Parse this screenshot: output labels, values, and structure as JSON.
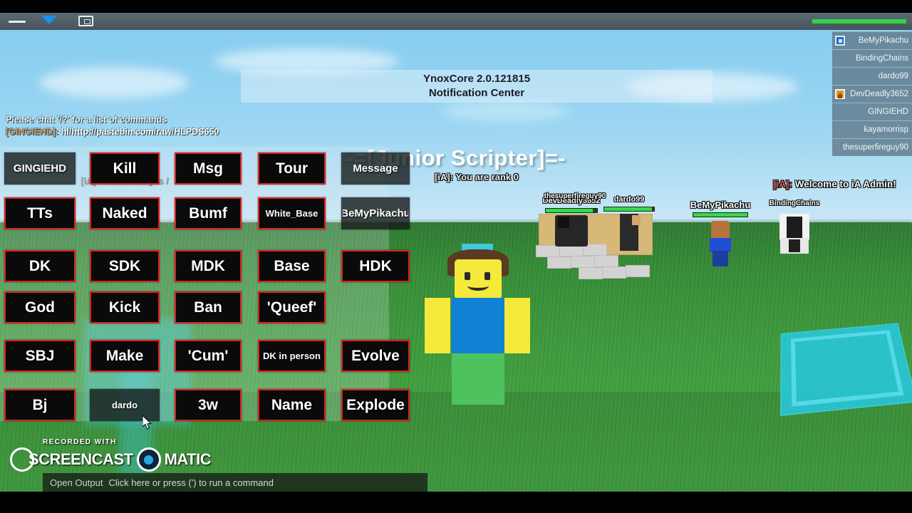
{
  "window": {
    "topbar": {
      "menu_icon": "hamburger-menu-icon",
      "chevron_icon": "chevron-down-icon",
      "camera_icon": "camera-icon",
      "health_label": "100"
    }
  },
  "notification_center": {
    "line1": "YnoxCore 2.0.121815",
    "line2": "Notification Center"
  },
  "chat": {
    "lines": [
      {
        "user": "",
        "text": "Please chat '/?' for a list of commands",
        "style": "system"
      },
      {
        "user": "[GINGIEHD]:",
        "text": "hl/http://pastebin.com/raw/HLPDS650",
        "style": "player"
      }
    ],
    "betkey_line": "[iA]: Your BetKey is /",
    "input_label": "Open Output",
    "input_hint": "Click here or press (') to run a command"
  },
  "world_text": {
    "title": "-=[Junior Scripter]=-",
    "rank_message": "[iA]: You are rank 0",
    "welcome_tag": "[iA]:",
    "welcome_message": " Welcome to iA Admin!"
  },
  "admin_panel": {
    "buttons": [
      {
        "label": "GINGIEHD",
        "style": "plain",
        "size": "md"
      },
      {
        "label": "Kill",
        "style": "red",
        "size": "lg"
      },
      {
        "label": "Msg",
        "style": "red",
        "size": "lg"
      },
      {
        "label": "Tour",
        "style": "red",
        "size": "lg"
      },
      {
        "label": "Message",
        "style": "plain",
        "size": "md"
      },
      {
        "label": "TTs",
        "style": "red",
        "size": "lg"
      },
      {
        "label": "Naked",
        "style": "red",
        "size": "lg"
      },
      {
        "label": "Bumf",
        "style": "red",
        "size": "lg"
      },
      {
        "label": "White_Base",
        "style": "red",
        "size": "sm"
      },
      {
        "label": "BeMyPikachu",
        "style": "plain",
        "size": "md"
      },
      {
        "label": "DK",
        "style": "red",
        "size": "lg"
      },
      {
        "label": "SDK",
        "style": "red",
        "size": "lg"
      },
      {
        "label": "MDK",
        "style": "red",
        "size": "lg"
      },
      {
        "label": "Base",
        "style": "red",
        "size": "lg"
      },
      {
        "label": "HDK",
        "style": "red",
        "size": "lg"
      },
      {
        "label": "God",
        "style": "red",
        "size": "lg"
      },
      {
        "label": "Kick",
        "style": "red",
        "size": "lg"
      },
      {
        "label": "Ban",
        "style": "red",
        "size": "lg"
      },
      {
        "label": "'Queef'",
        "style": "red",
        "size": "lg"
      },
      {
        "label": "",
        "style": "none",
        "size": "lg"
      },
      {
        "label": "SBJ",
        "style": "red",
        "size": "lg"
      },
      {
        "label": "Make",
        "style": "red",
        "size": "lg"
      },
      {
        "label": "'Cum'",
        "style": "red",
        "size": "lg"
      },
      {
        "label": "DK in person",
        "style": "red",
        "size": "sm"
      },
      {
        "label": "Evolve",
        "style": "red",
        "size": "lg"
      },
      {
        "label": "Bj",
        "style": "red",
        "size": "lg"
      },
      {
        "label": "dardo",
        "style": "plain",
        "size": "sm"
      },
      {
        "label": "3w",
        "style": "red",
        "size": "lg"
      },
      {
        "label": "Name",
        "style": "red",
        "size": "lg"
      },
      {
        "label": "Explode",
        "style": "red",
        "size": "lg"
      }
    ]
  },
  "player_list": {
    "players": [
      {
        "name": "BeMyPikachu",
        "badge": "blue"
      },
      {
        "name": "BindingChains",
        "badge": "none"
      },
      {
        "name": "dardo99",
        "badge": "none"
      },
      {
        "name": "DevDeadly3652",
        "badge": "gold"
      },
      {
        "name": "GINGIEHD",
        "badge": "none"
      },
      {
        "name": "kayamorrisp",
        "badge": "none"
      },
      {
        "name": "thesuperfireguy90",
        "badge": "none"
      }
    ]
  },
  "avatars": {
    "dev": {
      "name": "DevDeadly3652"
    },
    "dardo": {
      "name": "dardo99"
    },
    "fire": {
      "name": "thesuperfireguy90"
    },
    "pika": {
      "name": "BeMyPikachu"
    },
    "chains": {
      "name": "BindingChains"
    }
  },
  "watermark": {
    "recorded_with": "RECORDED WITH",
    "word1": "SCREENCAST",
    "word2": "MATIC"
  },
  "colors": {
    "button_border": "#e02020",
    "button_bg": "#0a0a0a",
    "health_green": "#2fd44a",
    "sky": "#87cdf0",
    "grass": "#3e9b3d",
    "cyan_part": "#2bc7dd"
  }
}
